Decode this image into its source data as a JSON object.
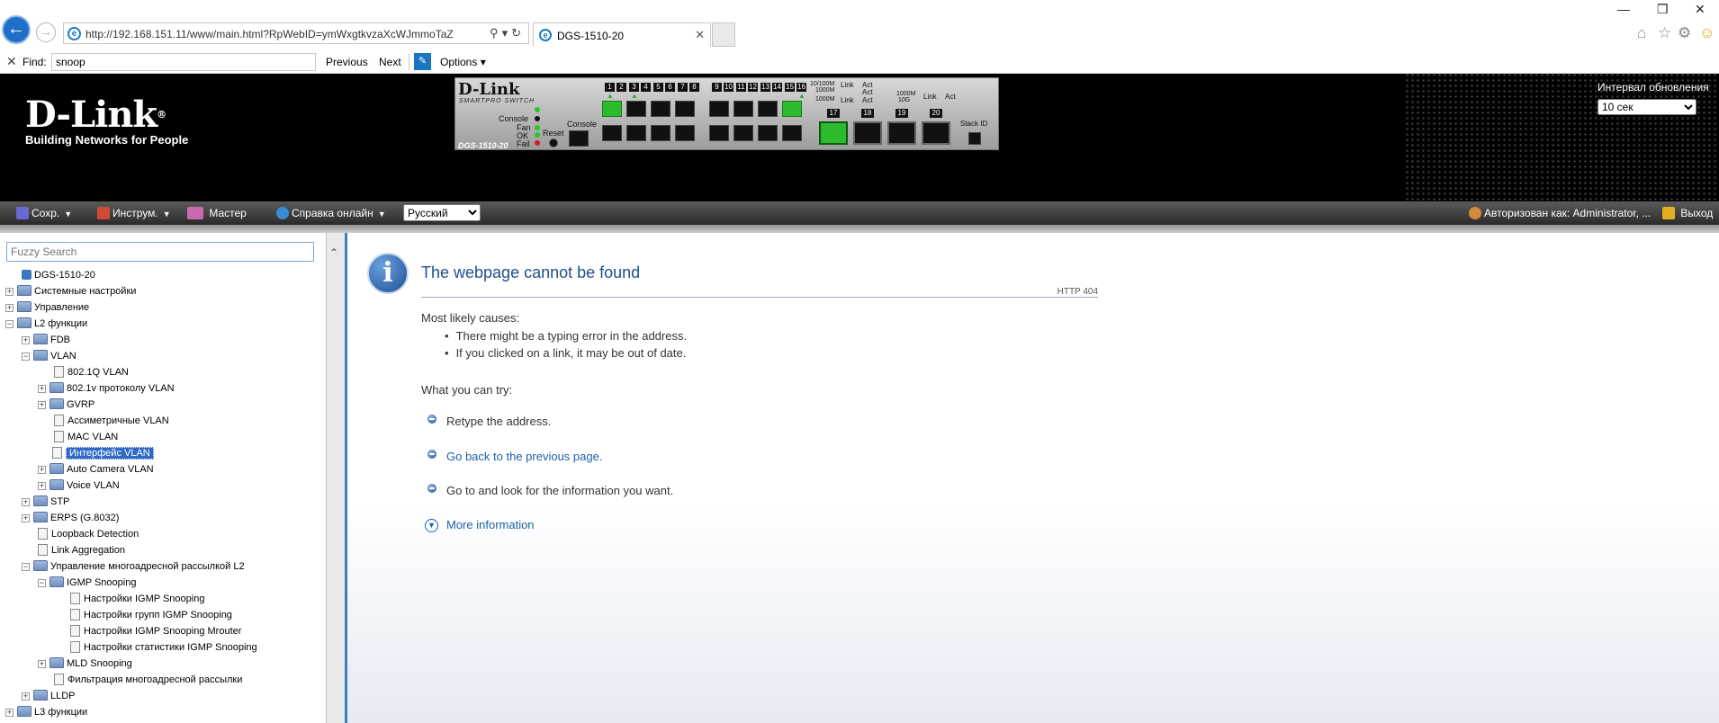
{
  "browser": {
    "address": "http://192.168.151.11/www/main.html?RpWebID=ymWxgtkvzaXcWJmmoTaZ",
    "tab_title": "DGS-1510-20",
    "find_label": "Find:",
    "find_value": "snoop",
    "previous_label": "Previous",
    "next_label": "Next",
    "options_label": "Options"
  },
  "header": {
    "logo_text": "D-Link",
    "logo_reg": "®",
    "logo_tagline": "Building Networks for People",
    "panel_brand": "D-Link",
    "panel_sub": "SMARTPRO SWITCH",
    "panel_model": "DGS-1510-20",
    "panel_labels": {
      "console": "Console",
      "fan": "Fan",
      "ok": "OK",
      "fail": "Fail",
      "reset": "Reset",
      "console_port": "Console",
      "stack": "Stack ID",
      "speed1": "10/100M",
      "speed2": "1000M",
      "speed3": "1000M",
      "link": "Link",
      "act": "Act",
      "sfp_speed1": "1000M",
      "sfp_speed2": "10G"
    },
    "port_numbers_top": [
      "1",
      "2",
      "3",
      "4",
      "5",
      "6",
      "7",
      "8",
      "9",
      "10",
      "11",
      "12",
      "13",
      "14",
      "15",
      "16"
    ],
    "sfp_numbers": [
      "17",
      "18",
      "19",
      "20"
    ],
    "refresh_label": "Интервал обновления",
    "refresh_value": "10 сек"
  },
  "menu": {
    "save": "Сохр.",
    "tools": "Инструм.",
    "wizard": "Мастер",
    "help": "Справка онлайн",
    "language": "Русский",
    "user": "Авторизован как: Administrator, ...",
    "logout": "Выход"
  },
  "tree": {
    "search_placeholder": "Fuzzy Search",
    "items": [
      {
        "label": "DGS-1510-20"
      },
      {
        "label": "Системные настройки"
      },
      {
        "label": "Управление"
      },
      {
        "label": "L2 функции"
      },
      {
        "label": "FDB"
      },
      {
        "label": "VLAN"
      },
      {
        "label": "802.1Q VLAN"
      },
      {
        "label": "802.1v протоколу VLAN"
      },
      {
        "label": "GVRP"
      },
      {
        "label": "Ассиметричные VLAN"
      },
      {
        "label": "MAC VLAN"
      },
      {
        "label": "Интерфейс VLAN"
      },
      {
        "label": "Auto Camera VLAN"
      },
      {
        "label": "Voice VLAN"
      },
      {
        "label": "STP"
      },
      {
        "label": "ERPS (G.8032)"
      },
      {
        "label": "Loopback Detection"
      },
      {
        "label": "Link Aggregation"
      },
      {
        "label": "Управление многоадресной рассылкой L2"
      },
      {
        "label": "IGMP Snooping"
      },
      {
        "label": "Настройки IGMP Snooping"
      },
      {
        "label": "Настройки групп IGMP Snooping"
      },
      {
        "label": "Настройки IGMP Snooping Mrouter"
      },
      {
        "label": "Настройки статистики IGMP Snooping"
      },
      {
        "label": "MLD Snooping"
      },
      {
        "label": "Фильтрация многоадресной рассылки"
      },
      {
        "label": "LLDP"
      },
      {
        "label": "L3 функции"
      }
    ]
  },
  "error": {
    "title": "The webpage cannot be found",
    "code": "HTTP 404",
    "causes_heading": "Most likely causes:",
    "causes": [
      "There might be a typing error in the address.",
      "If you clicked on a link, it may be out of date."
    ],
    "try_heading": "What you can try:",
    "try_items": [
      "Retype the address.",
      "Go back to the previous page.",
      "Go to  and look for the information you want."
    ],
    "more_info": "More information"
  }
}
